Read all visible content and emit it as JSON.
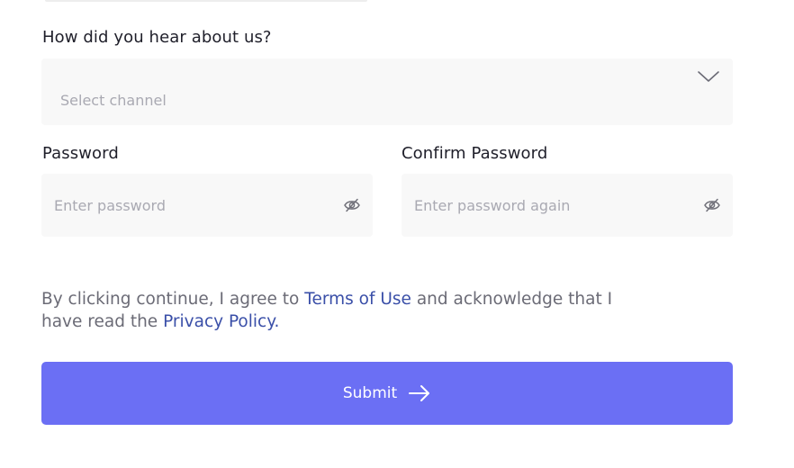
{
  "channel": {
    "label": "How did you hear about us?",
    "placeholder": "Select channel",
    "icon": "chevron-down-icon"
  },
  "password": {
    "label": "Password",
    "placeholder": "Enter password",
    "icon": "eye-off-icon"
  },
  "confirm_password": {
    "label": "Confirm Password",
    "placeholder": "Enter password again",
    "icon": "eye-off-icon"
  },
  "terms": {
    "prefix": "By clicking continue, I agree to",
    "terms_link": "Terms of Use",
    "middle": "and acknowledge that I have read the",
    "privacy_link": "Privacy Policy.",
    "link_color": "#3a4fa8"
  },
  "submit": {
    "label": "Submit",
    "icon": "arrow-right-icon",
    "color": "#6b6ff4"
  }
}
